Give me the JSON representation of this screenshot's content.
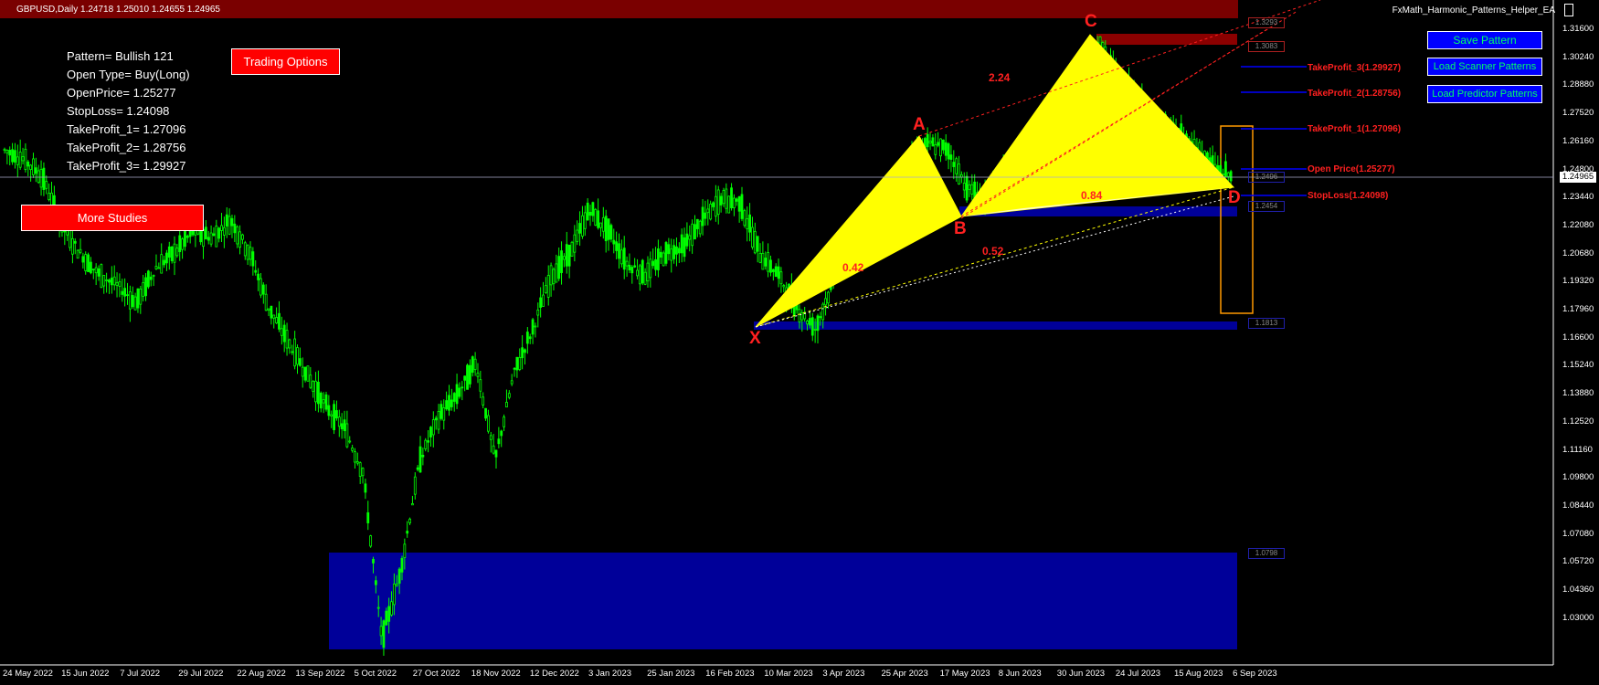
{
  "header": {
    "symbol_line": "GBPUSD,Daily  1.24718 1.25010 1.24655 1.24965",
    "ea_name": "FxMath_Harmonic_Patterns_Helper_EA"
  },
  "info_panel": {
    "pattern": "Pattern= Bullish 121",
    "open_type": "Open Type= Buy(Long)",
    "open_price": "OpenPrice= 1.25277",
    "stop_loss": "StopLoss= 1.24098",
    "tp1": "TakeProfit_1= 1.27096",
    "tp2": "TakeProfit_2= 1.28756",
    "tp3": "TakeProfit_3= 1.29927"
  },
  "buttons": {
    "trading_options": "Trading Options",
    "more_studies": "More Studies",
    "save_pattern": "Save Pattern",
    "load_scanner": "Load Scanner Patterns",
    "load_predictor": "Load Predictor Patterns"
  },
  "levels": {
    "tp3": "TakeProfit_3(1.29927)",
    "tp2": "TakeProfit_2(1.28756)",
    "tp1": "TakeProfit_1(1.27096)",
    "open": "Open Price(1.25277)",
    "sl": "StopLoss(1.24098)"
  },
  "pattern_points": {
    "x": "X",
    "a": "A",
    "b": "B",
    "c": "C",
    "d": "D"
  },
  "ratios": {
    "r1": "0.42",
    "r2": "2.24",
    "r3": "0.84",
    "r4": "0.52"
  },
  "small_boxes": {
    "b1": "1.3293",
    "b2": "1.3083",
    "b3": "1.2496",
    "b4": "1.2454",
    "b5": "1.1813",
    "b6": "1.0798"
  },
  "current_price": "1.24965",
  "colors": {
    "candle": "#00ff00",
    "pattern_fill": "#ffff00",
    "label_red": "#ff2020",
    "zone_blue": "#000099",
    "zone_red": "#8b0000"
  },
  "chart_data": {
    "type": "candlestick",
    "symbol": "GBPUSD",
    "timeframe": "Daily",
    "yticks": [
      "1.31600",
      "1.30240",
      "1.28880",
      "1.27520",
      "1.26160",
      "1.24800",
      "1.23440",
      "1.22080",
      "1.20680",
      "1.19320",
      "1.17960",
      "1.16600",
      "1.15240",
      "1.13880",
      "1.12520",
      "1.11160",
      "1.09800",
      "1.08440",
      "1.07080",
      "1.05720",
      "1.04360",
      "1.03000"
    ],
    "xticks": [
      "24 May 2022",
      "15 Jun 2022",
      "7 Jul 2022",
      "29 Jul 2022",
      "22 Aug 2022",
      "13 Sep 2022",
      "5 Oct 2022",
      "27 Oct 2022",
      "18 Nov 2022",
      "12 Dec 2022",
      "3 Jan 2023",
      "25 Jan 2023",
      "16 Feb 2023",
      "10 Mar 2023",
      "3 Apr 2023",
      "25 Apr 2023",
      "17 May 2023",
      "8 Jun 2023",
      "30 Jun 2023",
      "24 Jul 2023",
      "15 Aug 2023",
      "6 Sep 2023"
    ],
    "ylim": [
      1.03,
      1.316
    ],
    "price_path": [
      1.262,
      1.258,
      1.25,
      1.228,
      1.215,
      1.205,
      1.2,
      1.192,
      1.208,
      1.215,
      1.225,
      1.222,
      1.23,
      1.215,
      1.19,
      1.175,
      1.16,
      1.145,
      1.135,
      1.115,
      1.038,
      1.07,
      1.12,
      1.14,
      1.15,
      1.165,
      1.12,
      1.16,
      1.18,
      1.205,
      1.215,
      1.235,
      1.225,
      1.21,
      1.205,
      1.215,
      1.218,
      1.23,
      1.24,
      1.238,
      1.215,
      1.205,
      1.19,
      1.18,
      1.205,
      1.215,
      1.23,
      1.235,
      1.255,
      1.265,
      1.262,
      1.245,
      1.24,
      1.25,
      1.26,
      1.275,
      1.285,
      1.278,
      1.312,
      1.295,
      1.285,
      1.275,
      1.27,
      1.265,
      1.255,
      1.25
    ],
    "pattern": {
      "X": 1.182,
      "A": 1.267,
      "B": 1.24,
      "C": 1.315,
      "D": 1.245
    }
  }
}
